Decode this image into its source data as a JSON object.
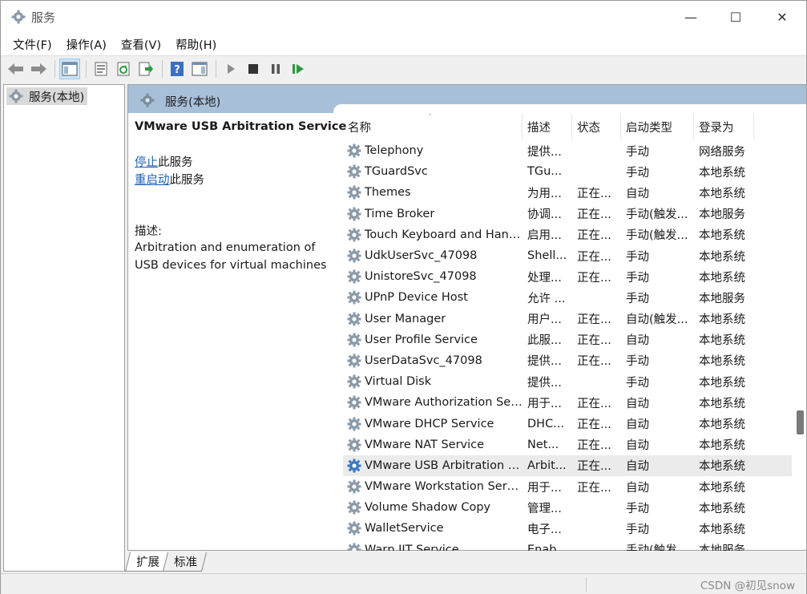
{
  "window": {
    "title": "服务",
    "controls": {
      "minimize": "—",
      "maximize": "☐",
      "close": "✕"
    }
  },
  "menu": [
    "文件(F)",
    "操作(A)",
    "查看(V)",
    "帮助(H)"
  ],
  "toolbar": {
    "icons": [
      "back-arrow-icon",
      "forward-arrow-icon",
      "show-hide-console-tree-icon",
      "properties-icon",
      "refresh-icon",
      "export-list-icon",
      "help-icon",
      "action-pane-icon",
      "start-service-icon",
      "stop-service-icon",
      "pause-service-icon",
      "resume-service-icon"
    ]
  },
  "tree": {
    "root_label": "服务(本地)"
  },
  "pane": {
    "header": "服务(本地)",
    "selected_service": "VMware USB Arbitration Service",
    "stop_link": "停止",
    "stop_suffix": "此服务",
    "restart_link": "重启动",
    "restart_suffix": "此服务",
    "desc_label": "描述:",
    "desc_text": "Arbitration and enumeration of USB devices for virtual machines"
  },
  "list": {
    "columns": [
      "名称",
      "描述",
      "状态",
      "启动类型",
      "登录为"
    ],
    "sort_indicator": "˄",
    "rows": [
      {
        "name": "Telephony",
        "desc": "提供...",
        "status": "",
        "type": "手动",
        "logon": "网络服务"
      },
      {
        "name": "TGuardSvc",
        "desc": "TGu...",
        "status": "",
        "type": "手动",
        "logon": "本地系统"
      },
      {
        "name": "Themes",
        "desc": "为用...",
        "status": "正在...",
        "type": "自动",
        "logon": "本地系统"
      },
      {
        "name": "Time Broker",
        "desc": "协调...",
        "status": "正在...",
        "type": "手动(触发...",
        "logon": "本地服务"
      },
      {
        "name": "Touch Keyboard and Hand...",
        "desc": "启用...",
        "status": "正在...",
        "type": "手动(触发...",
        "logon": "本地系统"
      },
      {
        "name": "UdkUserSvc_47098",
        "desc": "Shell...",
        "status": "正在...",
        "type": "手动",
        "logon": "本地系统"
      },
      {
        "name": "UnistoreSvc_47098",
        "desc": "处理...",
        "status": "正在...",
        "type": "手动",
        "logon": "本地系统"
      },
      {
        "name": "UPnP Device Host",
        "desc": "允许 ...",
        "status": "",
        "type": "手动",
        "logon": "本地服务"
      },
      {
        "name": "User Manager",
        "desc": "用户...",
        "status": "正在...",
        "type": "自动(触发...",
        "logon": "本地系统"
      },
      {
        "name": "User Profile Service",
        "desc": "此服...",
        "status": "正在...",
        "type": "自动",
        "logon": "本地系统"
      },
      {
        "name": "UserDataSvc_47098",
        "desc": "提供...",
        "status": "正在...",
        "type": "手动",
        "logon": "本地系统"
      },
      {
        "name": "Virtual Disk",
        "desc": "提供...",
        "status": "",
        "type": "手动",
        "logon": "本地系统"
      },
      {
        "name": "VMware Authorization Ser...",
        "desc": "用于...",
        "status": "正在...",
        "type": "自动",
        "logon": "本地系统"
      },
      {
        "name": "VMware DHCP Service",
        "desc": "DHC...",
        "status": "正在...",
        "type": "自动",
        "logon": "本地系统"
      },
      {
        "name": "VMware NAT Service",
        "desc": "Net...",
        "status": "正在...",
        "type": "自动",
        "logon": "本地系统"
      },
      {
        "name": "VMware USB Arbitration S...",
        "desc": "Arbit...",
        "status": "正在...",
        "type": "自动",
        "logon": "本地系统",
        "selected": true
      },
      {
        "name": "VMware Workstation Server",
        "desc": "用于...",
        "status": "正在...",
        "type": "自动",
        "logon": "本地系统"
      },
      {
        "name": "Volume Shadow Copy",
        "desc": "管理...",
        "status": "",
        "type": "手动",
        "logon": "本地系统"
      },
      {
        "name": "WalletService",
        "desc": "电子...",
        "status": "",
        "type": "手动",
        "logon": "本地系统"
      },
      {
        "name": "Warp JIT Service",
        "desc": "Enab...",
        "status": "",
        "type": "手动(触发...",
        "logon": "本地服务"
      }
    ]
  },
  "tabs": [
    "扩展",
    "标准"
  ],
  "status_bar": {
    "watermark": "CSDN @初见snow"
  },
  "colors": {
    "header_bg": "#a8bfd8",
    "link": "#1a5fb4",
    "gear_blue": "#3a78c2",
    "gear_grey": "#8a9aa8"
  }
}
